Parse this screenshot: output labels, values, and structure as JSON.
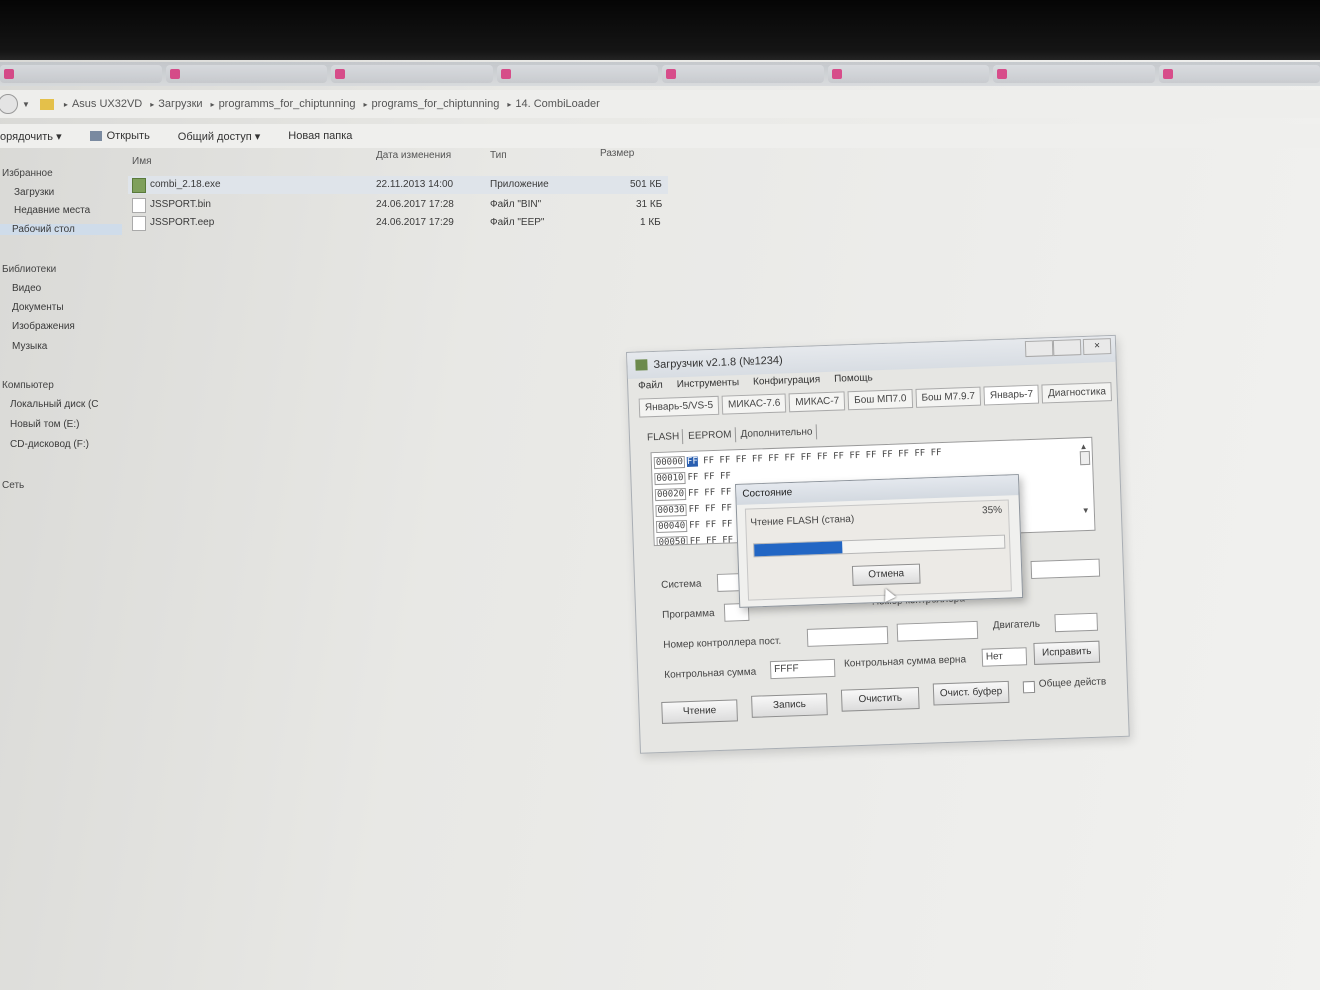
{
  "browser_tabs": [
    "",
    "",
    "",
    "",
    "",
    "",
    "",
    ""
  ],
  "address": {
    "crumbs": [
      "Asus UX32VD",
      "Загрузки",
      "programms_for_chiptunning",
      "programs_for_chiptunning",
      "14. CombiLoader"
    ]
  },
  "toolbar": {
    "organize": "орядочить ▾",
    "open": "Открыть",
    "share": "Общий доступ ▾",
    "new_folder": "Новая папка"
  },
  "nav": {
    "favorites": "Избранное",
    "downloads": "Загрузки",
    "recent": "Недавние места",
    "desktop": "Рабочий стол",
    "libraries": "Библиотеки",
    "video": "Видео",
    "documents": "Документы",
    "images": "Изображения",
    "music": "Музыка",
    "computer": "Компьютер",
    "local_disk": "Локальный диск (C",
    "new_volume": "Новый том (E:)",
    "cd_drive": "CD-дисковод (F:)",
    "network": "Сеть"
  },
  "columns": {
    "name": "Имя",
    "date": "Дата изменения",
    "type": "Тип",
    "size": "Размер"
  },
  "files": [
    {
      "name": "combi_2.18.exe",
      "date": "22.11.2013 14:00",
      "type": "Приложение",
      "size": "501 КБ"
    },
    {
      "name": "JSSPORT.bin",
      "date": "24.06.2017 17:28",
      "type": "Файл \"BIN\"",
      "size": "31 КБ"
    },
    {
      "name": "JSSPORT.eep",
      "date": "24.06.2017 17:29",
      "type": "Файл \"EEP\"",
      "size": "1 КБ"
    }
  ],
  "app": {
    "title": "Загрузчик v2.1.8 (№1234)",
    "menu": [
      "Файл",
      "Инструменты",
      "Конфигурация",
      "Помощь"
    ],
    "protocol_tabs": [
      "Январь-5/VS-5",
      "МИКАС-7.6",
      "МИКАС-7",
      "Бош МП7.0",
      "Бош М7.9.7",
      "Январь-7",
      "Диагностика"
    ],
    "sub_tabs": [
      "FLASH",
      "EEPROM",
      "Дополнительно"
    ],
    "hex_rows": [
      {
        "addr": "00000",
        "first": "FF",
        "bytes": "FF FF FF FF FF FF FF FF FF FF FF FF FF FF FF"
      },
      {
        "addr": "00010",
        "first": "",
        "bytes": "FF FF FF"
      },
      {
        "addr": "00020",
        "first": "",
        "bytes": "FF FF FF"
      },
      {
        "addr": "00030",
        "first": "",
        "bytes": "FF FF FF"
      },
      {
        "addr": "00040",
        "first": "",
        "bytes": "FF FF FF"
      },
      {
        "addr": "00050",
        "first": "",
        "bytes": "FF FF FF"
      }
    ],
    "labels": {
      "system": "Система",
      "program": "Программа",
      "controller_number_label": "Номер контроллера",
      "controller_number_supplier": "Номер контроллера пост.",
      "engine": "Двигатель",
      "checksum": "Контрольная сумма",
      "checksum_ok": "Контрольная сумма верна"
    },
    "fields": {
      "checksum": "FFFF",
      "checksum_ok": "Нет"
    },
    "buttons": {
      "fix": "Исправить",
      "read": "Чтение",
      "write": "Запись",
      "clear": "Очистить",
      "clear_buffer": "Очист. буфер"
    },
    "checkbox_label": "Общее действ"
  },
  "dialog": {
    "title": "Состояние",
    "status": "Чтение FLASH (стана)",
    "percent_text": "35%",
    "progress": 0.35,
    "cancel": "Отмена"
  },
  "colors": {
    "progress": "#2266c4",
    "selection": "#2a5fb0"
  }
}
